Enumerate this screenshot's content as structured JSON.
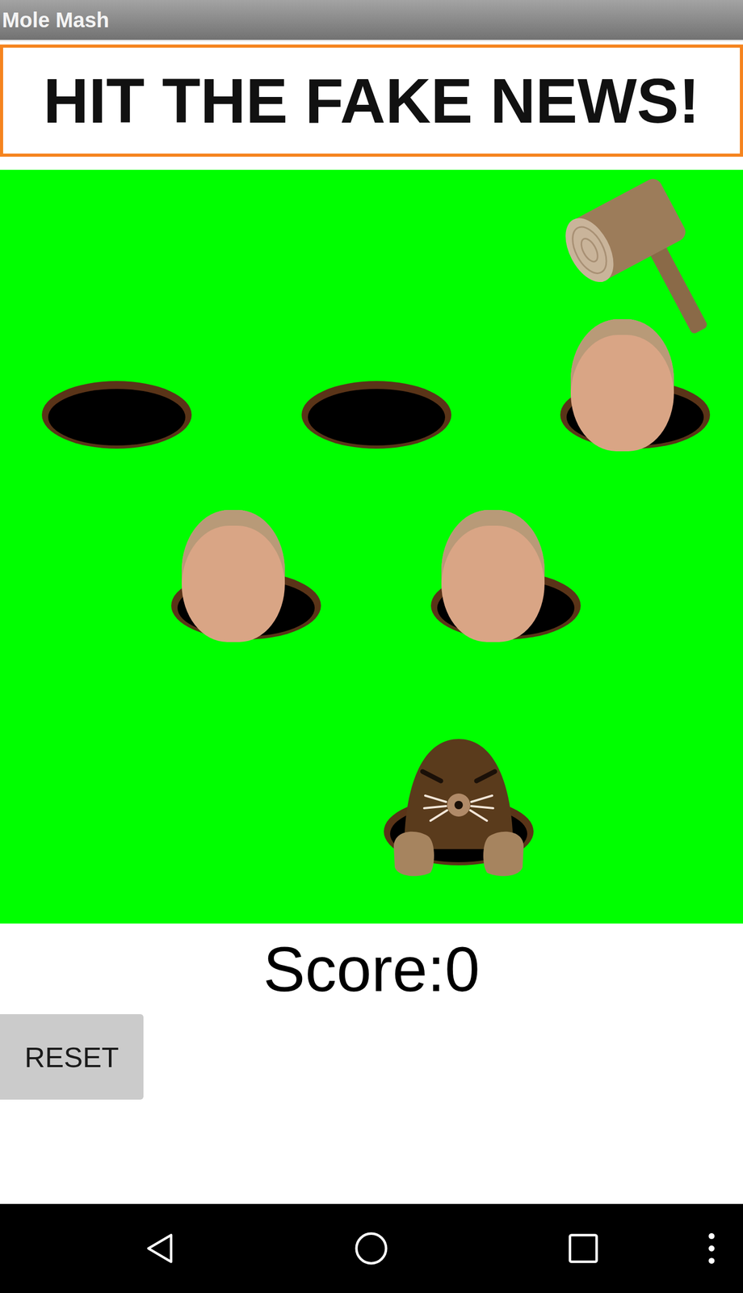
{
  "window": {
    "title": "Mole Mash"
  },
  "banner": {
    "text": "HIT THE FAKE NEWS!"
  },
  "field": {
    "holes": [
      {
        "kind": "empty"
      },
      {
        "kind": "empty"
      },
      {
        "kind": "photo"
      },
      {
        "kind": "photo"
      },
      {
        "kind": "photo"
      },
      {
        "kind": "mole"
      }
    ]
  },
  "score": {
    "text": "Score:0"
  },
  "buttons": [
    {
      "label": "RESET"
    }
  ]
}
